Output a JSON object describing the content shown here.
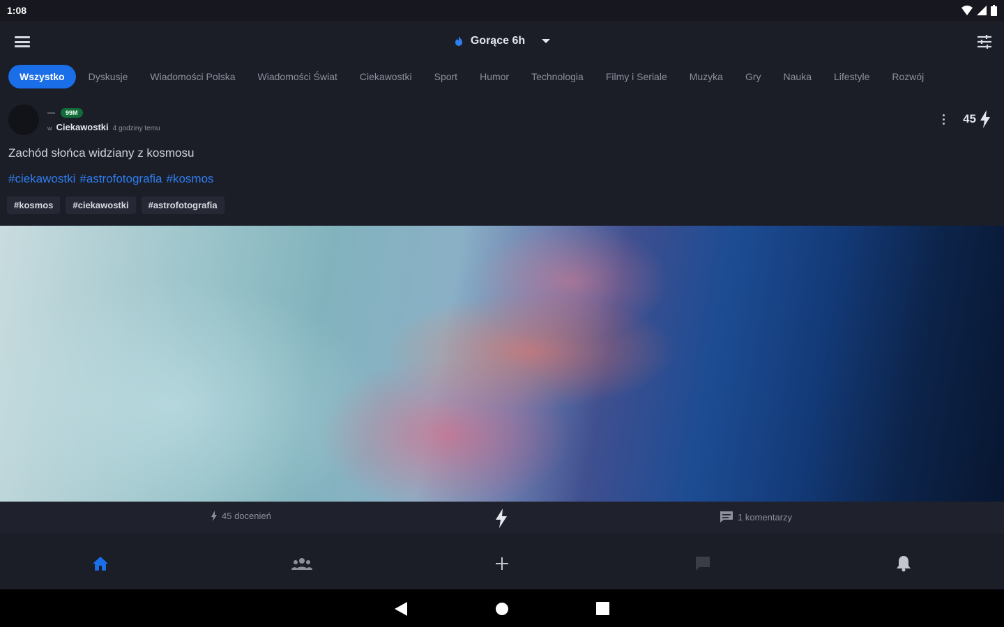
{
  "status": {
    "time": "1:08"
  },
  "top_bar": {
    "feed_label": "Gorące 6h"
  },
  "categories": [
    "Wszystko",
    "Dyskusje",
    "Wiadomości Polska",
    "Wiadomości Świat",
    "Ciekawostki",
    "Sport",
    "Humor",
    "Technologia",
    "Filmy i Seriale",
    "Muzyka",
    "Gry",
    "Nauka",
    "Lifestyle",
    "Rozwój"
  ],
  "post": {
    "author": "—",
    "badge": "99M",
    "community_prefix": "w",
    "community": "Ciekawostki",
    "time": "4 godziny temu",
    "score": "45",
    "title": "Zachód słońca widziany z kosmosu",
    "hashtags": [
      "#ciekawostki",
      "#astrofotografia",
      "#kosmos"
    ],
    "tags": [
      "#kosmos",
      "#ciekawostki",
      "#astrofotografia"
    ]
  },
  "footer": {
    "likes": "45 docenień",
    "comments": "1 komentarzy"
  },
  "colors": {
    "accent": "#1a6ee8",
    "background": "#1b1d27",
    "badge": "#146b3a",
    "hashtag": "#2f7ff0"
  }
}
